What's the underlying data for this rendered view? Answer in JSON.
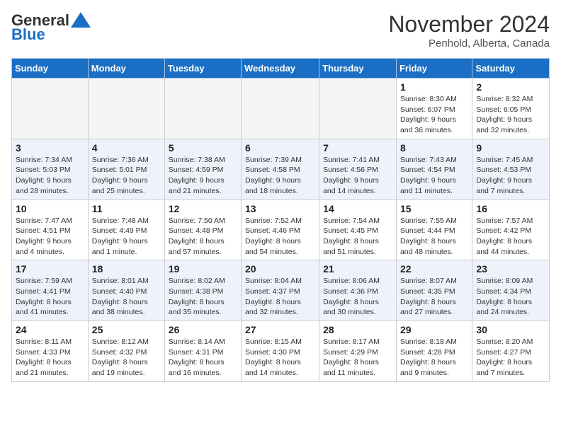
{
  "header": {
    "logo_general": "General",
    "logo_blue": "Blue",
    "month_title": "November 2024",
    "location": "Penhold, Alberta, Canada"
  },
  "weekdays": [
    "Sunday",
    "Monday",
    "Tuesday",
    "Wednesday",
    "Thursday",
    "Friday",
    "Saturday"
  ],
  "weeks": [
    [
      {
        "day": "",
        "info": ""
      },
      {
        "day": "",
        "info": ""
      },
      {
        "day": "",
        "info": ""
      },
      {
        "day": "",
        "info": ""
      },
      {
        "day": "",
        "info": ""
      },
      {
        "day": "1",
        "info": "Sunrise: 8:30 AM\nSunset: 6:07 PM\nDaylight: 9 hours\nand 36 minutes."
      },
      {
        "day": "2",
        "info": "Sunrise: 8:32 AM\nSunset: 6:05 PM\nDaylight: 9 hours\nand 32 minutes."
      }
    ],
    [
      {
        "day": "3",
        "info": "Sunrise: 7:34 AM\nSunset: 5:03 PM\nDaylight: 9 hours\nand 28 minutes."
      },
      {
        "day": "4",
        "info": "Sunrise: 7:36 AM\nSunset: 5:01 PM\nDaylight: 9 hours\nand 25 minutes."
      },
      {
        "day": "5",
        "info": "Sunrise: 7:38 AM\nSunset: 4:59 PM\nDaylight: 9 hours\nand 21 minutes."
      },
      {
        "day": "6",
        "info": "Sunrise: 7:39 AM\nSunset: 4:58 PM\nDaylight: 9 hours\nand 18 minutes."
      },
      {
        "day": "7",
        "info": "Sunrise: 7:41 AM\nSunset: 4:56 PM\nDaylight: 9 hours\nand 14 minutes."
      },
      {
        "day": "8",
        "info": "Sunrise: 7:43 AM\nSunset: 4:54 PM\nDaylight: 9 hours\nand 11 minutes."
      },
      {
        "day": "9",
        "info": "Sunrise: 7:45 AM\nSunset: 4:53 PM\nDaylight: 9 hours\nand 7 minutes."
      }
    ],
    [
      {
        "day": "10",
        "info": "Sunrise: 7:47 AM\nSunset: 4:51 PM\nDaylight: 9 hours\nand 4 minutes."
      },
      {
        "day": "11",
        "info": "Sunrise: 7:48 AM\nSunset: 4:49 PM\nDaylight: 9 hours\nand 1 minute."
      },
      {
        "day": "12",
        "info": "Sunrise: 7:50 AM\nSunset: 4:48 PM\nDaylight: 8 hours\nand 57 minutes."
      },
      {
        "day": "13",
        "info": "Sunrise: 7:52 AM\nSunset: 4:46 PM\nDaylight: 8 hours\nand 54 minutes."
      },
      {
        "day": "14",
        "info": "Sunrise: 7:54 AM\nSunset: 4:45 PM\nDaylight: 8 hours\nand 51 minutes."
      },
      {
        "day": "15",
        "info": "Sunrise: 7:55 AM\nSunset: 4:44 PM\nDaylight: 8 hours\nand 48 minutes."
      },
      {
        "day": "16",
        "info": "Sunrise: 7:57 AM\nSunset: 4:42 PM\nDaylight: 8 hours\nand 44 minutes."
      }
    ],
    [
      {
        "day": "17",
        "info": "Sunrise: 7:59 AM\nSunset: 4:41 PM\nDaylight: 8 hours\nand 41 minutes."
      },
      {
        "day": "18",
        "info": "Sunrise: 8:01 AM\nSunset: 4:40 PM\nDaylight: 8 hours\nand 38 minutes."
      },
      {
        "day": "19",
        "info": "Sunrise: 8:02 AM\nSunset: 4:38 PM\nDaylight: 8 hours\nand 35 minutes."
      },
      {
        "day": "20",
        "info": "Sunrise: 8:04 AM\nSunset: 4:37 PM\nDaylight: 8 hours\nand 32 minutes."
      },
      {
        "day": "21",
        "info": "Sunrise: 8:06 AM\nSunset: 4:36 PM\nDaylight: 8 hours\nand 30 minutes."
      },
      {
        "day": "22",
        "info": "Sunrise: 8:07 AM\nSunset: 4:35 PM\nDaylight: 8 hours\nand 27 minutes."
      },
      {
        "day": "23",
        "info": "Sunrise: 8:09 AM\nSunset: 4:34 PM\nDaylight: 8 hours\nand 24 minutes."
      }
    ],
    [
      {
        "day": "24",
        "info": "Sunrise: 8:11 AM\nSunset: 4:33 PM\nDaylight: 8 hours\nand 21 minutes."
      },
      {
        "day": "25",
        "info": "Sunrise: 8:12 AM\nSunset: 4:32 PM\nDaylight: 8 hours\nand 19 minutes."
      },
      {
        "day": "26",
        "info": "Sunrise: 8:14 AM\nSunset: 4:31 PM\nDaylight: 8 hours\nand 16 minutes."
      },
      {
        "day": "27",
        "info": "Sunrise: 8:15 AM\nSunset: 4:30 PM\nDaylight: 8 hours\nand 14 minutes."
      },
      {
        "day": "28",
        "info": "Sunrise: 8:17 AM\nSunset: 4:29 PM\nDaylight: 8 hours\nand 11 minutes."
      },
      {
        "day": "29",
        "info": "Sunrise: 8:18 AM\nSunset: 4:28 PM\nDaylight: 8 hours\nand 9 minutes."
      },
      {
        "day": "30",
        "info": "Sunrise: 8:20 AM\nSunset: 4:27 PM\nDaylight: 8 hours\nand 7 minutes."
      }
    ]
  ]
}
